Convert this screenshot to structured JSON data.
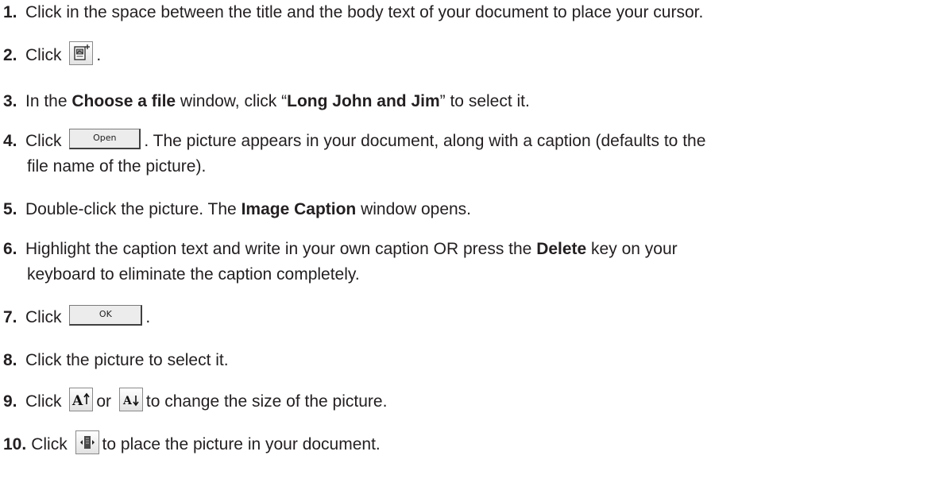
{
  "steps": [
    {
      "num": "1.",
      "text": "Click in the space between the title and the body text of your document to place your cursor."
    },
    {
      "num": "2.",
      "pre": "Click",
      "post": "."
    },
    {
      "num": "3.",
      "pre": "In the ",
      "bold1": "Choose a file",
      "mid1": " window, click “",
      "bold2": "Long John and Jim",
      "post": "” to select it."
    },
    {
      "num": "4.",
      "pre": "Click",
      "button": "Open",
      "post": ". The picture appears in your document, along with a caption (defaults to the",
      "cont": "file name of the picture)."
    },
    {
      "num": "5.",
      "pre": "Double-click the picture. The ",
      "bold1": "Image Caption",
      "post": " window opens."
    },
    {
      "num": "6.",
      "pre": "Highlight the caption text and write in your own caption OR press the ",
      "bold1": "Delete",
      "post": " key on your",
      "cont": "keyboard to eliminate the caption completely."
    },
    {
      "num": "7.",
      "pre": "Click",
      "button": "OK",
      "post": "."
    },
    {
      "num": "8.",
      "text": "Click the picture to select it."
    },
    {
      "num": "9.",
      "pre": "Click",
      "mid1": "or",
      "post": "to change the size of the picture."
    },
    {
      "num": "10.",
      "pre": "Click",
      "post": "to place the picture in your document."
    }
  ],
  "icons": {
    "insert_picture": "insert-picture-icon",
    "increase_size": "increase-size-icon",
    "decrease_size": "decrease-size-icon",
    "place_picture": "place-picture-icon"
  }
}
